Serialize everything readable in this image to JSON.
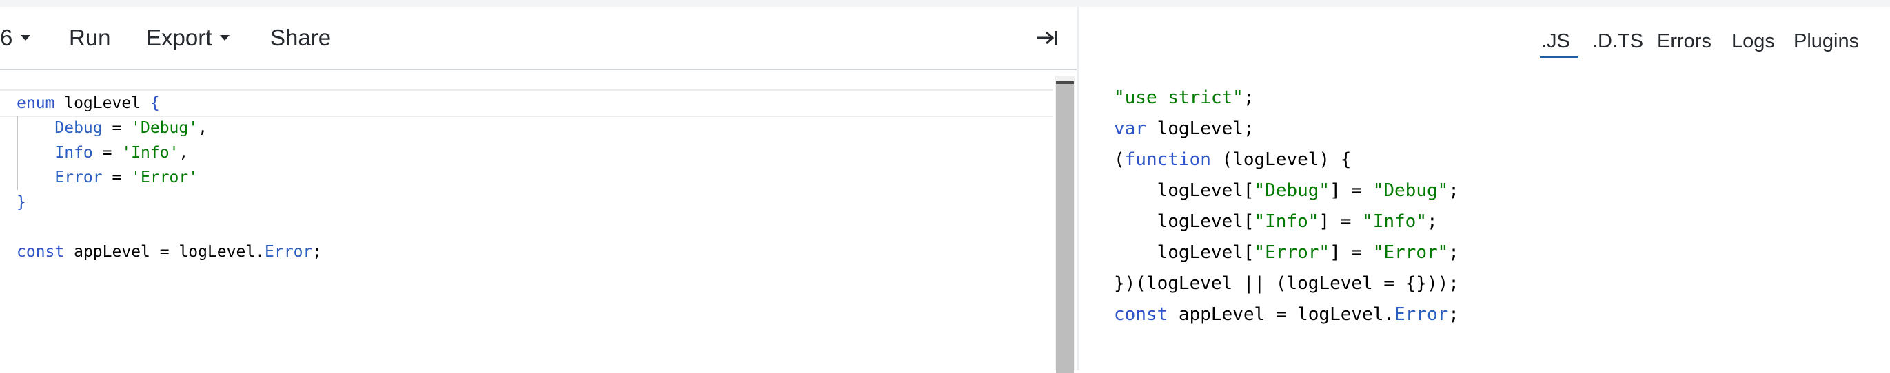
{
  "toolbar": {
    "version_label": "6",
    "run_label": "Run",
    "export_label": "Export",
    "share_label": "Share",
    "collapse_icon": "collapse-panel-icon"
  },
  "editor": {
    "lines": [
      {
        "a": "enum",
        "b": " logLevel ",
        "c": "{"
      },
      {
        "a": "    Debug",
        "b": " = ",
        "c": "'Debug'",
        "d": ","
      },
      {
        "a": "    Info",
        "b": " = ",
        "c": "'Info'",
        "d": ","
      },
      {
        "a": "    Error",
        "b": " = ",
        "c": "'Error'"
      },
      {
        "a": "}"
      },
      {
        "a": ""
      },
      {
        "a": "const",
        "b": " appLevel = logLevel.",
        "c": "Error",
        "d": ";"
      }
    ]
  },
  "output": {
    "tabs": [
      ".JS",
      ".D.TS",
      "Errors",
      "Logs",
      "Plugins"
    ],
    "active_tab": ".JS",
    "lines": [
      {
        "a": "\"use strict\"",
        "b": ";"
      },
      {
        "a": "var",
        "b": " logLevel;"
      },
      {
        "a": "(",
        "b": "function",
        "c": " (logLevel) {"
      },
      {
        "a": "    logLevel[",
        "b": "\"Debug\"",
        "c": "] = ",
        "d": "\"Debug\"",
        "e": ";"
      },
      {
        "a": "    logLevel[",
        "b": "\"Info\"",
        "c": "] = ",
        "d": "\"Info\"",
        "e": ";"
      },
      {
        "a": "    logLevel[",
        "b": "\"Error\"",
        "c": "] = ",
        "d": "\"Error\"",
        "e": ";"
      },
      {
        "a": "})(logLevel || (logLevel = {}));"
      },
      {
        "a": "const",
        "b": " appLevel = logLevel.",
        "c": "Error",
        "d": ";"
      }
    ]
  },
  "colors": {
    "keyword": "#2f55c9",
    "string": "#007a00",
    "tab_underline": "#1f5fa8"
  }
}
